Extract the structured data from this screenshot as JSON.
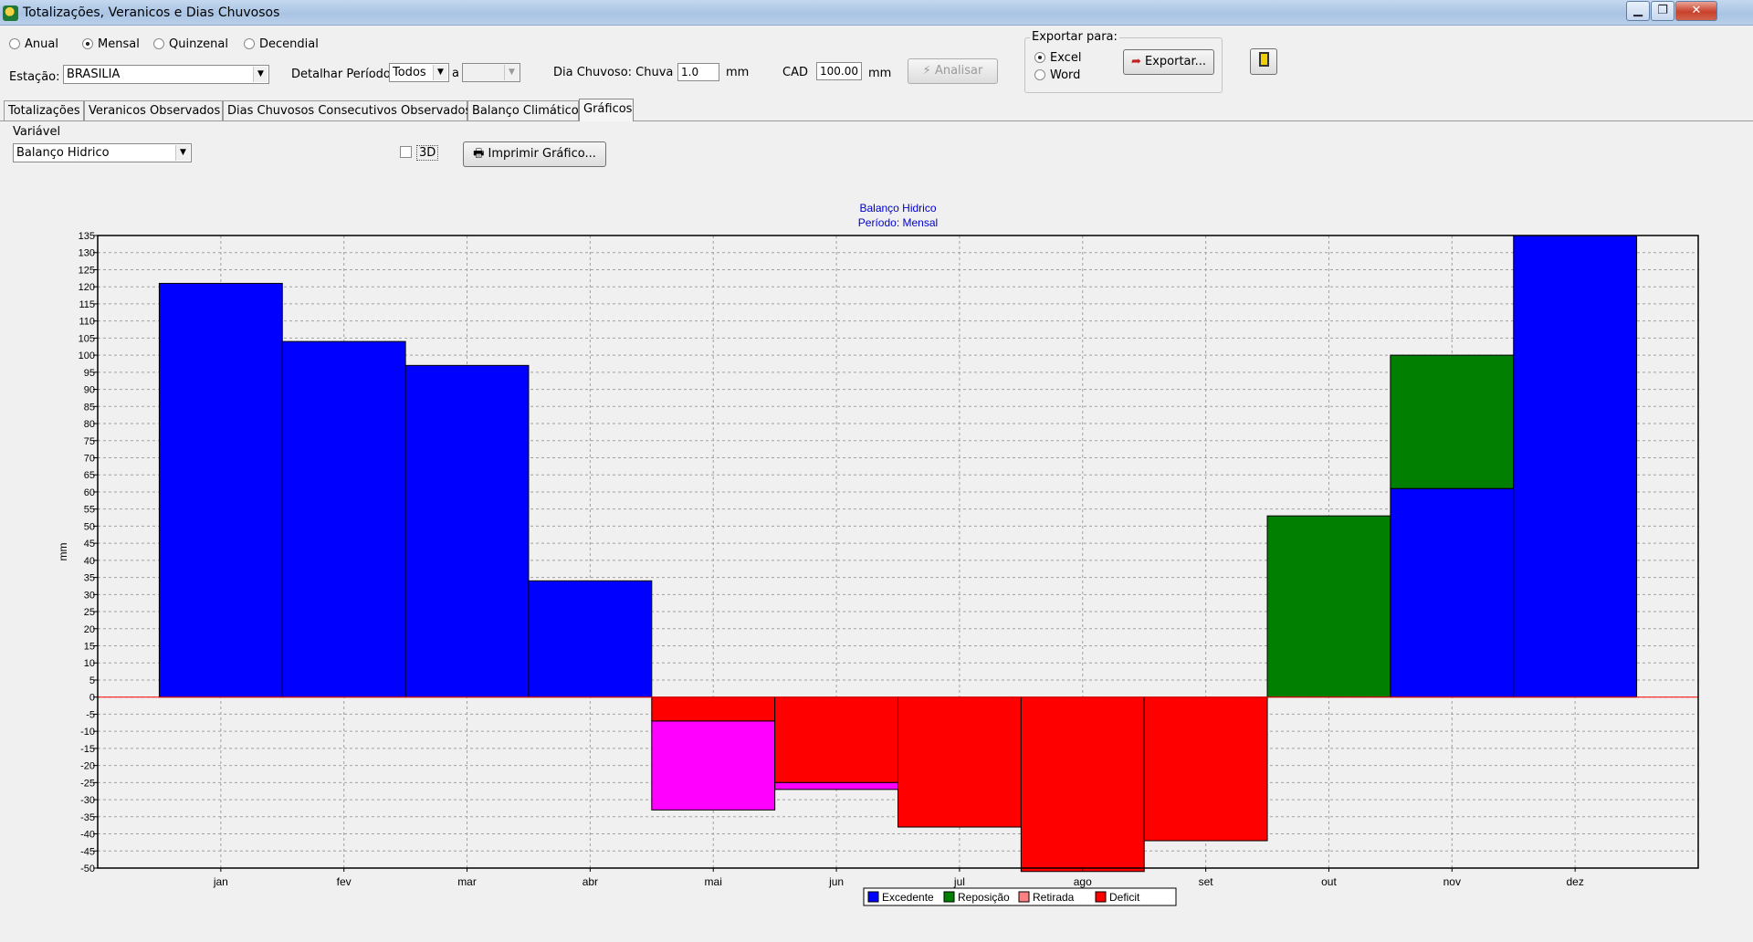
{
  "window": {
    "title": "Totalizações, Veranicos e Dias Chuvosos",
    "minimize": "▁",
    "restore": "❐",
    "close": "✕"
  },
  "period": {
    "options": [
      "Anual",
      "Mensal",
      "Quinzenal",
      "Decendial"
    ],
    "selected": "Mensal"
  },
  "station": {
    "label": "Estação:",
    "value": "BRASILIA"
  },
  "detail": {
    "label": "Detalhar Período",
    "from": "Todos",
    "to_label": "a",
    "to": ""
  },
  "rainy_day": {
    "label": "Dia Chuvoso: Chuva >",
    "value": "1.0",
    "unit": "mm"
  },
  "cad": {
    "label": "CAD",
    "value": "100.00",
    "unit": "mm"
  },
  "analyze_button": "Analisar",
  "export": {
    "title": "Exportar para:",
    "options": [
      "Excel",
      "Word"
    ],
    "selected": "Excel",
    "button": "Exportar..."
  },
  "tabs": [
    "Totalizações",
    "Veranicos Observados",
    "Dias Chuvosos Consecutivos Observados",
    "Balanço Climático",
    "Gráficos"
  ],
  "active_tab": "Gráficos",
  "variable": {
    "label": "Variável",
    "value": "Balanço Hidrico"
  },
  "three_d": {
    "label": "3D",
    "checked": false
  },
  "print_button": "Imprimir Gráfico...",
  "colors": {
    "Excedente": "#0000ff",
    "Reposição": "#007f00",
    "Retirada": "#ff00ff",
    "Deficit": "#ff0000",
    "title": "#0000cc"
  },
  "chart_data": {
    "type": "bar",
    "stacked": true,
    "title": "Balanço Hidrico",
    "subtitle": "Período: Mensal",
    "ylabel": "mm",
    "xlabel": "",
    "ylim": [
      -50,
      135
    ],
    "ytick_step": 5,
    "grid": true,
    "legend_position": "bottom-center",
    "legend": [
      "Excedente",
      "Reposição",
      "Retirada",
      "Deficit"
    ],
    "categories": [
      "jan",
      "fev",
      "mar",
      "abr",
      "mai",
      "jun",
      "jul",
      "ago",
      "set",
      "out",
      "nov",
      "dez"
    ],
    "series": [
      {
        "name": "Excedente",
        "values": [
          121,
          104,
          97,
          34,
          0,
          0,
          0,
          0,
          0,
          0,
          61,
          135
        ]
      },
      {
        "name": "Reposição",
        "values": [
          0,
          0,
          0,
          0,
          0,
          0,
          0,
          0,
          0,
          53,
          39,
          0
        ]
      },
      {
        "name": "Deficit",
        "values": [
          0,
          0,
          0,
          0,
          -7,
          -25,
          -38,
          -51,
          -42,
          0,
          0,
          0
        ]
      },
      {
        "name": "Retirada",
        "values": [
          0,
          0,
          0,
          0,
          -26,
          -2,
          0,
          0,
          0,
          0,
          0,
          0
        ]
      }
    ]
  }
}
